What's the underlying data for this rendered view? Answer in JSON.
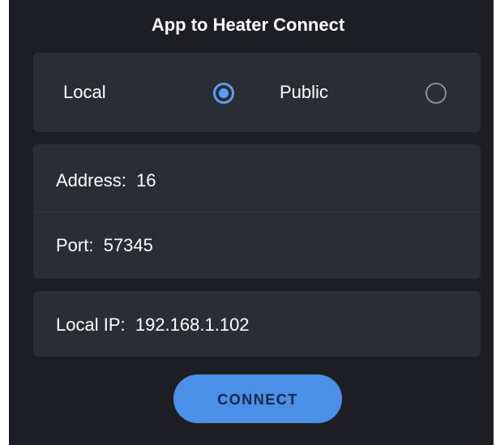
{
  "title": "App to Heater Connect",
  "mode": {
    "local_label": "Local",
    "public_label": "Public",
    "selected": "Local"
  },
  "address": {
    "label": "Address:",
    "value": "16"
  },
  "port": {
    "label": "Port:",
    "value": "57345"
  },
  "local_ip": {
    "label": "Local IP:",
    "value": "192.168.1.102"
  },
  "connect_label": "CONNECT",
  "colors": {
    "background": "#1c1e23",
    "card": "#2a2d34",
    "accent": "#4a90e8",
    "radio_selected": "#5b9cf8",
    "radio_unselected": "#8a8d93"
  }
}
